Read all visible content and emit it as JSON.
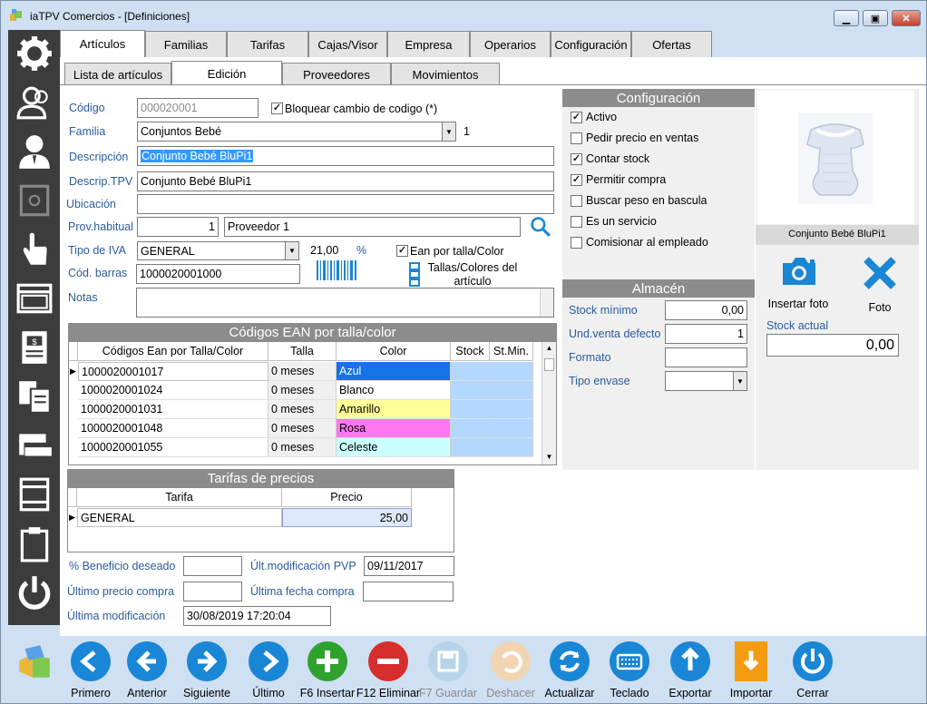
{
  "window": {
    "title": "iaTPV Comercios - [Definiciones]",
    "minimize": "▁",
    "restore": "▣",
    "close": "✕"
  },
  "tabs": [
    "Artículos",
    "Familias",
    "Tarifas",
    "Cajas/Visor",
    "Empresa",
    "Operarios",
    "Configuración",
    "Ofertas"
  ],
  "subtabs": [
    "Lista de artículos",
    "Edición",
    "Proveedores",
    "Movimientos"
  ],
  "form": {
    "codigo_label": "Código",
    "codigo_value": "000020001",
    "bloquear_label": "Bloquear cambio de codigo (*)",
    "familia_label": "Familia",
    "familia_value": "Conjuntos Bebé",
    "familia_num": "1",
    "descripcion_label": "Descripción",
    "descripcion_value": "Conjunto Bebé BluPi1",
    "descrip_tpv_label": "Descrip.TPV",
    "descrip_tpv_value": "Conjunto Bebé BluPi1",
    "ubicacion_label": "Ubicación",
    "ubicacion_value": "",
    "prov_label": "Prov.habitual",
    "prov_num": "1",
    "prov_name": "Proveedor 1",
    "iva_label": "Tipo de IVA",
    "iva_value": "GENERAL",
    "iva_pct": "21,00",
    "iva_unit": "%",
    "ean_talla_label": "Ean por talla/Color",
    "barras_label": "Cód. barras",
    "barras_value": "1000020001000",
    "tallas_label": "Tallas/Colores del artículo",
    "notas_label": "Notas",
    "notas_value": ""
  },
  "ean_section": {
    "title": "Códigos EAN por talla/color",
    "columns": [
      "Códigos Ean por Talla/Color",
      "Talla",
      "Color",
      "Stock",
      "St.Min."
    ],
    "rows": [
      {
        "code": "1000020001017",
        "talla": "0 meses",
        "color": "Azul",
        "color_hex": "#1573e8",
        "text": "#ffffff"
      },
      {
        "code": "1000020001024",
        "talla": "0 meses",
        "color": "Blanco",
        "color_hex": "#ffffff",
        "text": "#000000"
      },
      {
        "code": "1000020001031",
        "talla": "0 meses",
        "color": "Amarillo",
        "color_hex": "#ffff99",
        "text": "#000000"
      },
      {
        "code": "1000020001048",
        "talla": "0 meses",
        "color": "Rosa",
        "color_hex": "#ff77ee",
        "text": "#000000"
      },
      {
        "code": "1000020001055",
        "talla": "0 meses",
        "color": "Celeste",
        "color_hex": "#ccffff",
        "text": "#000000"
      }
    ]
  },
  "tarifas": {
    "title": "Tarifas de precios",
    "columns": [
      "Tarifa",
      "Precio"
    ],
    "rows": [
      {
        "tarifa": "GENERAL",
        "precio": "25,00"
      }
    ]
  },
  "footer_fields": {
    "beneficio_label": "% Beneficio deseado",
    "beneficio_value": "",
    "ult_mod_pvp_label": "Últ.modificación PVP",
    "ult_mod_pvp_value": "09/11/2017",
    "ultimo_precio_label": "Último precio compra",
    "ultimo_precio_value": "",
    "ultima_fecha_label": "Última fecha compra",
    "ultima_fecha_value": "",
    "ultima_mod_label": "Última modificación",
    "ultima_mod_value": "30/08/2019 17:20:04"
  },
  "config": {
    "title": "Configuración",
    "options": [
      {
        "label": "Activo",
        "checked": true
      },
      {
        "label": "Pedir precio en ventas",
        "checked": false
      },
      {
        "label": "Contar stock",
        "checked": true
      },
      {
        "label": "Permitir compra",
        "checked": true
      },
      {
        "label": "Buscar peso en bascula",
        "checked": false
      },
      {
        "label": "Es un servicio",
        "checked": false
      },
      {
        "label": "Comisionar al empleado",
        "checked": false
      }
    ]
  },
  "almacen": {
    "title": "Almacén",
    "stock_min_label": "Stock mínimo",
    "stock_min_value": "0,00",
    "und_venta_label": "Und.venta defecto",
    "und_venta_value": "1",
    "formato_label": "Formato",
    "formato_value": "",
    "envase_label": "Tipo envase",
    "envase_value": ""
  },
  "photo": {
    "caption": "Conjunto Bebé BluPi1",
    "insert_label": "Insertar foto",
    "delete_label": "Foto",
    "stock_actual_label": "Stock actual",
    "stock_actual_value": "0,00"
  },
  "toolbar": [
    {
      "label": "Primero",
      "icon": "first-icon",
      "color": "#1a86d6",
      "enabled": true
    },
    {
      "label": "Anterior",
      "icon": "prev-icon",
      "color": "#1a86d6",
      "enabled": true
    },
    {
      "label": "Siguiente",
      "icon": "next-icon",
      "color": "#1a86d6",
      "enabled": true
    },
    {
      "label": "Último",
      "icon": "last-icon",
      "color": "#1a86d6",
      "enabled": true
    },
    {
      "label": "F6 Insertar",
      "icon": "plus-icon",
      "color": "#2fa12f",
      "enabled": true
    },
    {
      "label": "F12 Eliminar",
      "icon": "minus-icon",
      "color": "#d62d2d",
      "enabled": true
    },
    {
      "label": "F7 Guardar",
      "icon": "save-icon",
      "color": "#b8d4ea",
      "enabled": false
    },
    {
      "label": "Deshacer",
      "icon": "undo-icon",
      "color": "#f1d5b3",
      "enabled": false
    },
    {
      "label": "Actualizar",
      "icon": "refresh-icon",
      "color": "#1a86d6",
      "enabled": true
    },
    {
      "label": "Teclado",
      "icon": "keyboard-icon",
      "color": "#1a86d6",
      "enabled": true
    },
    {
      "label": "Exportar",
      "icon": "export-icon",
      "color": "#1a86d6",
      "enabled": true
    },
    {
      "label": "Importar",
      "icon": "import-icon",
      "color": "#f39c12",
      "enabled": true
    },
    {
      "label": "Cerrar",
      "icon": "power-icon",
      "color": "#1a86d6",
      "enabled": true
    }
  ],
  "sidebar_icons": [
    "gear-icon",
    "users-icon",
    "operator-icon",
    "safe-icon",
    "hand-pointer-icon",
    "window-icon",
    "receipt-icon",
    "documents-icon",
    "arrows-icon",
    "printer-icon",
    "clipboard-icon",
    "power-icon",
    "box-icon"
  ]
}
